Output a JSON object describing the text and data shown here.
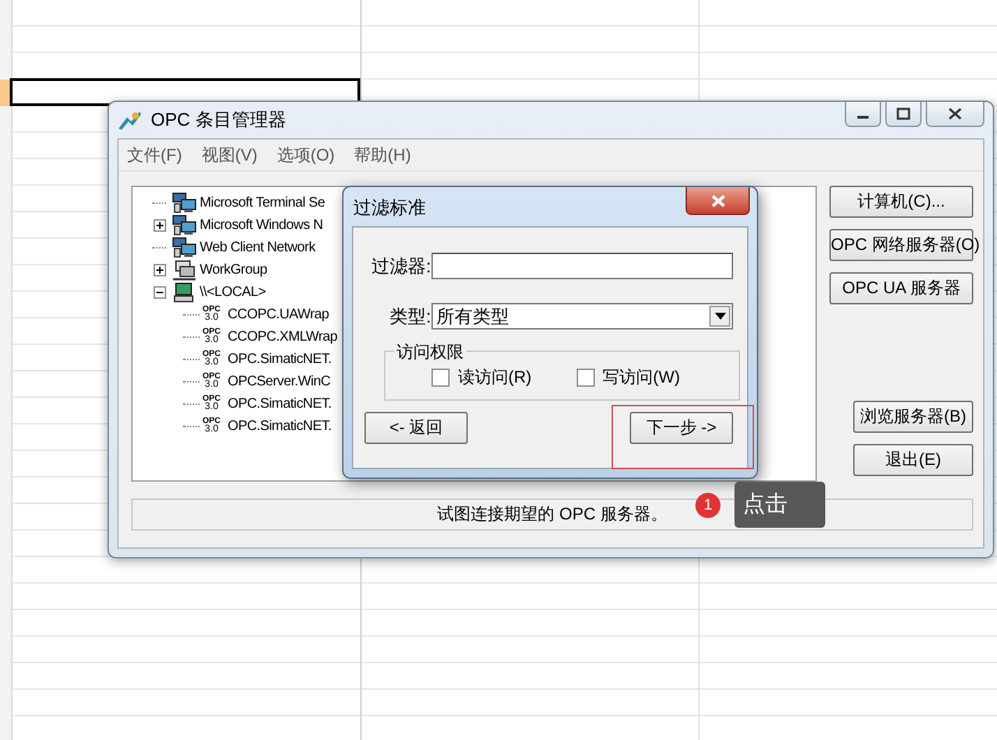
{
  "window": {
    "title": "OPC 条目管理器"
  },
  "menu": [
    "文件(F)",
    "视图(V)",
    "选项(O)",
    "帮助(H)"
  ],
  "tree": [
    {
      "label": "Microsoft Terminal Se",
      "kind": "network"
    },
    {
      "label": "Microsoft Windows N",
      "kind": "network",
      "expanded": false
    },
    {
      "label": "Web Client Network",
      "kind": "network"
    },
    {
      "label": "WorkGroup",
      "kind": "workgroup",
      "expanded": false
    },
    {
      "label": "\\\\<LOCAL>",
      "kind": "computer",
      "expanded": true,
      "children": [
        {
          "label": "CCOPC.UAWrap",
          "kind": "opc",
          "icon_text": [
            "OPC",
            "3.0"
          ]
        },
        {
          "label": "CCOPC.XMLWrap",
          "kind": "opc",
          "icon_text": [
            "OPC",
            "3.0"
          ]
        },
        {
          "label": "OPC.SimaticNET.",
          "kind": "opc",
          "icon_text": [
            "OPC",
            "3.0"
          ]
        },
        {
          "label": "OPCServer.WinC",
          "kind": "opc",
          "icon_text": [
            "OPC",
            "3.0"
          ]
        },
        {
          "label": "OPC.SimaticNET.",
          "kind": "opc",
          "icon_text": [
            "OPC",
            "3.0"
          ]
        },
        {
          "label": "OPC.SimaticNET.",
          "kind": "opc",
          "icon_text": [
            "OPC",
            "3.0"
          ]
        }
      ]
    }
  ],
  "side_buttons_top": [
    "计算机(C)...",
    "OPC 网络服务器(O)",
    "OPC UA 服务器"
  ],
  "side_buttons_bottom": [
    "浏览服务器(B)",
    "退出(E)"
  ],
  "status_bar": "试图连接期望的 OPC 服务器。",
  "dialog": {
    "title": "过滤标准",
    "filter_label": "过滤器:",
    "type_label": "类型:",
    "type_value": "所有类型",
    "access_group": "访问权限",
    "checkboxes": [
      {
        "label": "读访问(R)",
        "checked": false
      },
      {
        "label": "写访问(W)",
        "checked": false
      }
    ],
    "back_button": "<- 返回",
    "next_button": "下一步 ->",
    "next_highlighted": true
  },
  "annotation": {
    "step": "1",
    "text": "点击"
  }
}
